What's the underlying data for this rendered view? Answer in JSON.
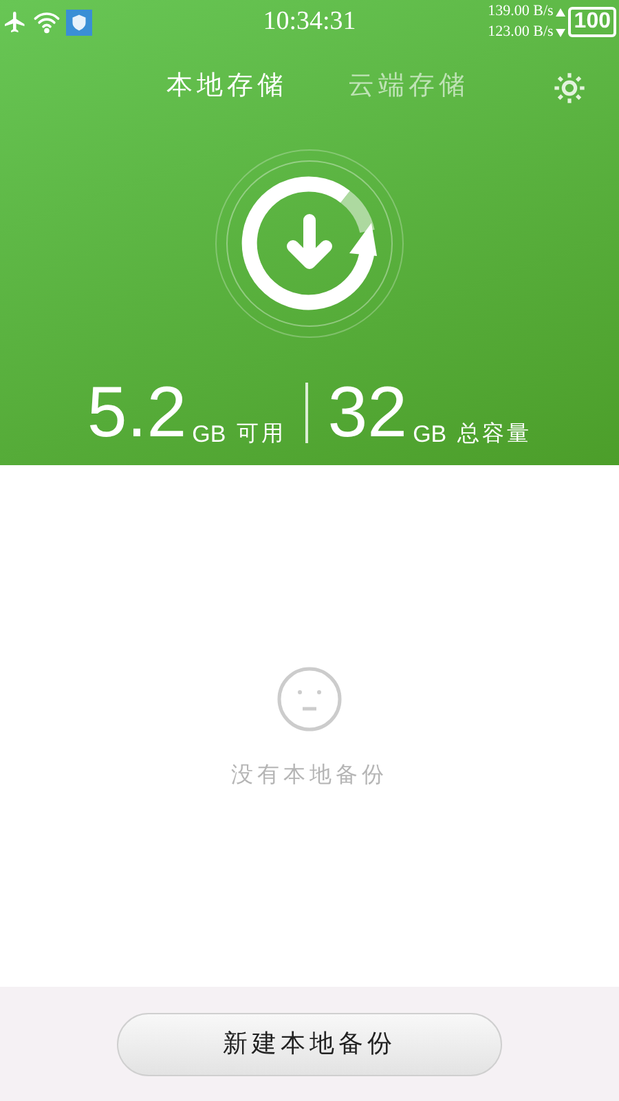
{
  "status_bar": {
    "time": "10:34:31",
    "upload_speed": "139.00 B/s",
    "download_speed": "123.00 B/s",
    "battery": "100"
  },
  "tabs": [
    {
      "label": "本地存储",
      "selected": true
    },
    {
      "label": "云端存储",
      "selected": false
    }
  ],
  "storage": [
    {
      "value": "5.2",
      "unit": "GB",
      "label": "可用"
    },
    {
      "value": "32",
      "unit": "GB",
      "label": "总容量"
    }
  ],
  "empty_state": {
    "message": "没有本地备份"
  },
  "action_button": {
    "label": "新建本地备份"
  }
}
